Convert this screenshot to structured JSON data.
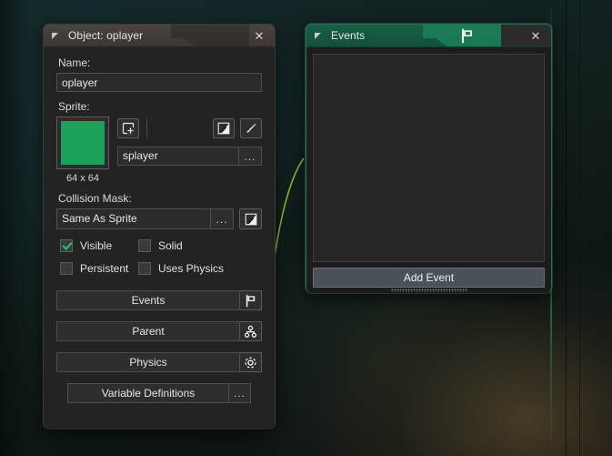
{
  "object_window": {
    "title": "Object: oplayer",
    "caret_icon": "collapse-caret-icon",
    "close_icon": "close-icon",
    "name_label": "Name:",
    "name_value": "oplayer",
    "sprite_label": "Sprite:",
    "sprite_size": "64 x 64",
    "sprite_color": "#1ba158",
    "sprite_name": "splayer",
    "sprite_dots": "...",
    "sprite_tools": [
      {
        "name": "new-sprite-icon",
        "title": "New Sprite"
      },
      {
        "name": "edit-image-icon",
        "title": "Edit Image"
      },
      {
        "name": "paintbrush-icon",
        "title": "Edit Sprite"
      }
    ],
    "collision_label": "Collision Mask:",
    "collision_value": "Same As Sprite",
    "collision_dots": "...",
    "collision_edit_icon": "edit-image-icon",
    "checkboxes": [
      {
        "label": "Visible",
        "checked": true
      },
      {
        "label": "Solid",
        "checked": false
      },
      {
        "label": "Persistent",
        "checked": false
      },
      {
        "label": "Uses Physics",
        "checked": false
      }
    ],
    "buttons": [
      {
        "label": "Events",
        "icon": "flag-icon"
      },
      {
        "label": "Parent",
        "icon": "parent-node-icon"
      },
      {
        "label": "Physics",
        "icon": "physics-atom-icon"
      }
    ],
    "variable_definitions_label": "Variable Definitions",
    "variable_definitions_dots": "..."
  },
  "events_window": {
    "title": "Events",
    "caret_icon": "collapse-caret-icon",
    "flag_icon": "flag-icon",
    "close_icon": "close-icon",
    "add_event_label": "Add Event",
    "events": [],
    "accent_color": "#2a6f52",
    "titlebar_color": "#145039",
    "resize_grip": "resize-grip"
  }
}
